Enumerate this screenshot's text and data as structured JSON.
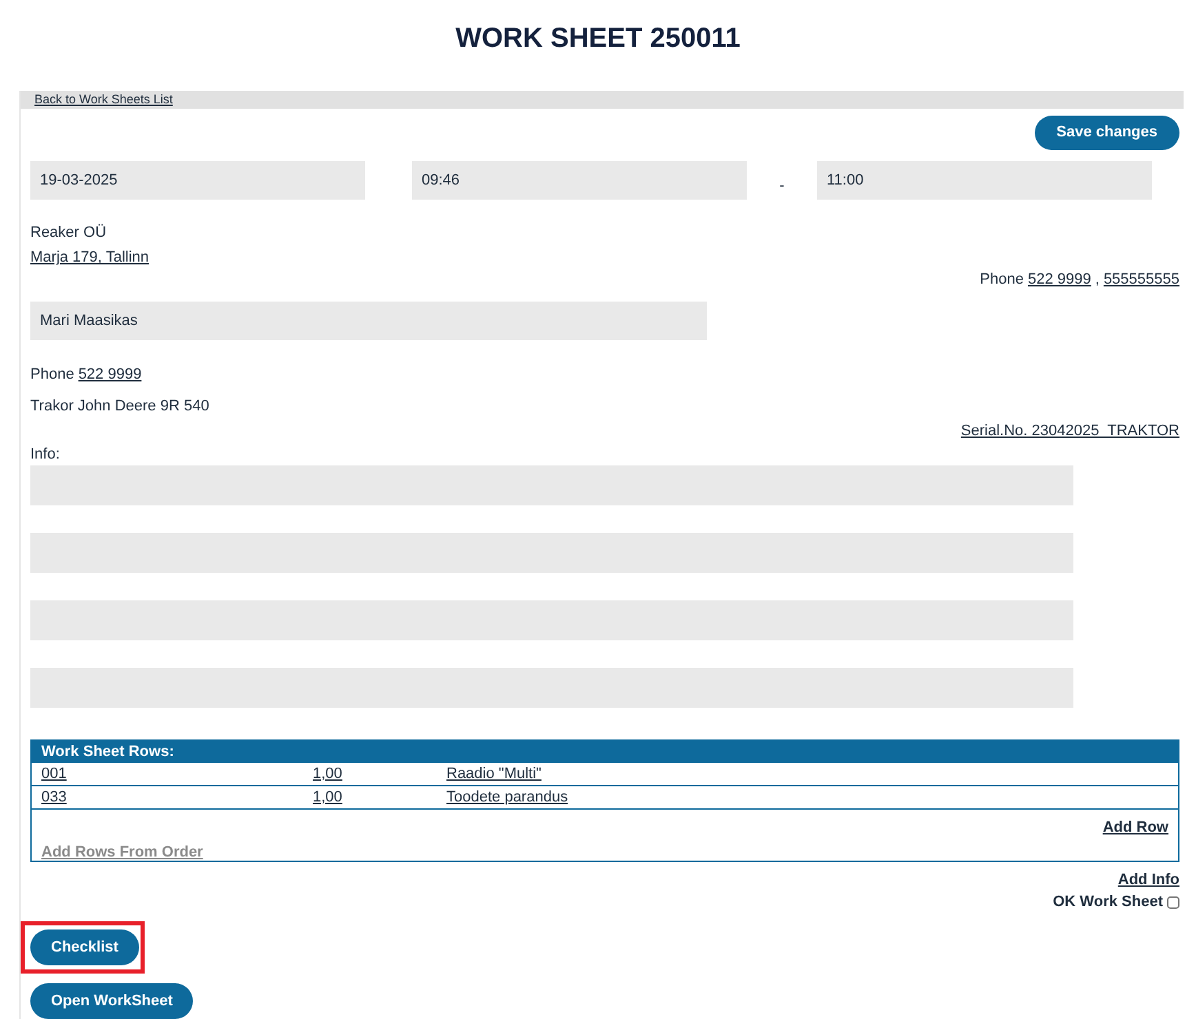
{
  "title": "WORK SHEET 250011",
  "back_link": "Back to Work Sheets List",
  "save_button": "Save changes",
  "time": {
    "date": "19-03-2025",
    "start": "09:46",
    "separator": "-",
    "end": "11:00"
  },
  "client": {
    "name": "Reaker OÜ",
    "address": "Marja 179, Tallinn",
    "phone_label": "Phone",
    "phones": [
      "522 9999",
      "555555555"
    ],
    "phone_separator": ","
  },
  "contact": {
    "name": "Mari Maasikas",
    "phone_label": "Phone",
    "phone": "522 9999"
  },
  "device": {
    "name": "Trakor John Deere 9R 540",
    "serial": "Serial.No. 23042025  TRAKTOR"
  },
  "info": {
    "label": "Info:",
    "fields": [
      {
        "kind": "textarea"
      },
      {
        "kind": "textarea"
      },
      {
        "kind": "textarea"
      },
      {
        "kind": "textarea"
      }
    ]
  },
  "rows_table": {
    "title": "Work Sheet Rows:",
    "rows": [
      {
        "code": "001",
        "quantity": "1,00",
        "name": "Raadio \"Multi\""
      },
      {
        "code": "033",
        "quantity": "1,00",
        "name": "Toodete parandus"
      }
    ],
    "add_row": "Add Row",
    "add_from_order": {
      "label": "Add Rows From Order",
      "disabled": true
    }
  },
  "add_info": "Add Info",
  "ok_work_sheet": {
    "label": "OK Work Sheet",
    "checked": false
  },
  "buttons": [
    {
      "label": "Checklist",
      "highlighted": true
    },
    {
      "label": "Open WorkSheet",
      "highlighted": false
    }
  ]
}
